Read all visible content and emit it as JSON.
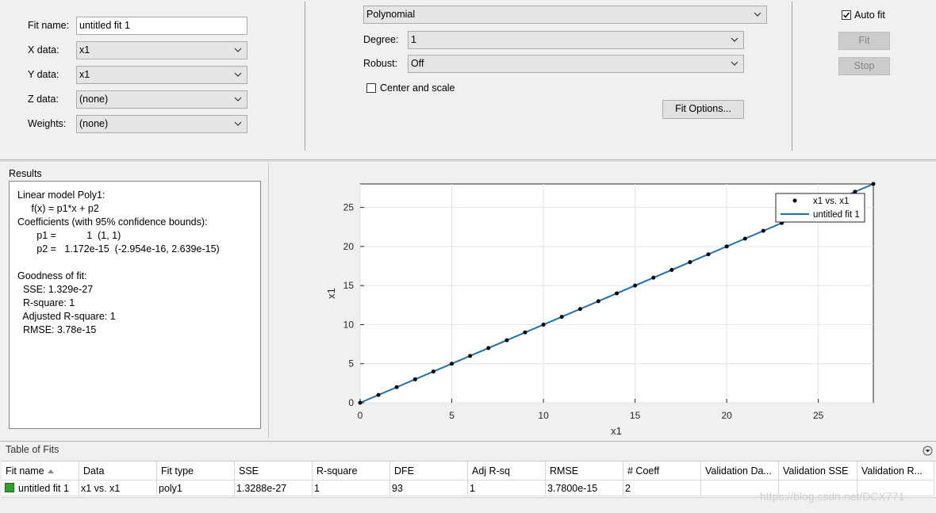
{
  "data_panel": {
    "fit_name_label": "Fit name:",
    "fit_name_value": "untitled fit 1",
    "x_data_label": "X data:",
    "x_data_value": "x1",
    "y_data_label": "Y data:",
    "y_data_value": "x1",
    "z_data_label": "Z data:",
    "z_data_value": "(none)",
    "weights_label": "Weights:",
    "weights_value": "(none)"
  },
  "fit_type_panel": {
    "fit_type_value": "Polynomial",
    "degree_label": "Degree:",
    "degree_value": "1",
    "robust_label": "Robust:",
    "robust_value": "Off",
    "center_scale_label": "Center and scale",
    "center_scale_checked": false,
    "fit_options_label": "Fit Options..."
  },
  "fit_controls": {
    "auto_fit_label": "Auto fit",
    "auto_fit_checked": true,
    "fit_label": "Fit",
    "stop_label": "Stop"
  },
  "results": {
    "title": "Results",
    "lines": [
      "Linear model Poly1:",
      "     f(x) = p1*x + p2",
      "Coefficients (with 95% confidence bounds):",
      "       p1 =           1  (1, 1)",
      "       p2 =   1.172e-15  (-2.954e-16, 2.639e-15)",
      "",
      "Goodness of fit:",
      "  SSE: 1.329e-27",
      "  R-square: 1",
      "  Adjusted R-square: 1",
      "  RMSE: 3.78e-15"
    ]
  },
  "chart_data": {
    "type": "scatter",
    "xlabel": "x1",
    "ylabel": "x1",
    "xlim": [
      0,
      28
    ],
    "ylim": [
      0,
      28
    ],
    "xticks": [
      0,
      5,
      10,
      15,
      20,
      25
    ],
    "yticks": [
      0,
      5,
      10,
      15,
      20,
      25
    ],
    "grid": true,
    "legend_position": "top-right",
    "series": [
      {
        "name": "x1 vs. x1",
        "style": "markers",
        "color": "#000000",
        "x": [
          0,
          1,
          2,
          3,
          4,
          5,
          6,
          7,
          8,
          9,
          10,
          11,
          12,
          13,
          14,
          15,
          16,
          17,
          18,
          19,
          20,
          21,
          22,
          23,
          24,
          25,
          26,
          27,
          28
        ],
        "y": [
          0,
          1,
          2,
          3,
          4,
          5,
          6,
          7,
          8,
          9,
          10,
          11,
          12,
          13,
          14,
          15,
          16,
          17,
          18,
          19,
          20,
          21,
          22,
          23,
          24,
          25,
          26,
          27,
          28
        ]
      },
      {
        "name": "untitled fit 1",
        "style": "line",
        "color": "#1f6fb5",
        "x": [
          0,
          28
        ],
        "y": [
          0,
          28
        ]
      }
    ]
  },
  "table_of_fits": {
    "title": "Table of Fits",
    "columns": [
      "Fit name",
      "Data",
      "Fit type",
      "SSE",
      "R-square",
      "DFE",
      "Adj R-sq",
      "RMSE",
      "# Coeff",
      "Validation Da...",
      "Validation SSE",
      "Validation R..."
    ],
    "rows": [
      [
        "untitled fit 1",
        "x1 vs. x1",
        "poly1",
        "1.3288e-27",
        "1",
        "93",
        "1",
        "3.7800e-15",
        "2",
        "",
        "",
        ""
      ]
    ],
    "status_color": "#2ca02c"
  },
  "watermark": "https://blog.csdn.net/DCX771"
}
